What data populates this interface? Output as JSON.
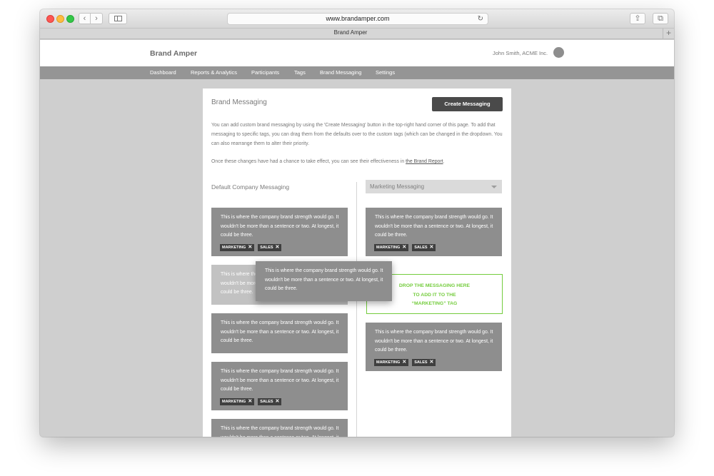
{
  "browser": {
    "url": "www.brandamper.com",
    "tab_title": "Brand Amper",
    "new_tab_glyph": "+",
    "back_glyph": "‹",
    "forward_glyph": "›",
    "reload_glyph": "↻",
    "share_glyph": "⇪",
    "tabs_glyph": "⧉"
  },
  "app": {
    "brand": "Brand Amper",
    "user": "John Smith, ACME Inc."
  },
  "nav": {
    "items": [
      "Dashboard",
      "Reports & Analytics",
      "Participants",
      "Tags",
      "Brand Messaging",
      "Settings"
    ]
  },
  "page": {
    "title": "Brand Messaging",
    "create_button": "Create Messaging",
    "intro": "You can add custom brand messaging by using the 'Create Messaging' button in the top-right hand corner of this page. To add that messaging to specific tags, you can drag them from the defaults over to the custom tags (which can be changed in the dropdown. You can also rearrange them to alter their priority.",
    "intro2_before": "Once these changes have had a chance to take effect, you can see their effectiveness in ",
    "intro2_link": "the Brand Report",
    "intro2_after": "."
  },
  "left_column": {
    "title": "Default Company Messaging",
    "cards": [
      {
        "text": "This is where the company brand strength would go. It wouldn't be more than a sentence or two. At longest, it could be three.",
        "tags": [
          "MARKETING",
          "SALES"
        ]
      },
      {
        "text": "This is where the company brand strength would go. It wouldn't be more than a sentence or two. At longest, it could be three.",
        "tags": []
      },
      {
        "text": "This is where the company brand strength would go. It wouldn't be more than a sentence or two. At longest, it could be three.",
        "tags": []
      },
      {
        "text": "This is where the company brand strength would go. It wouldn't be more than a sentence or two. At longest, it could be three.",
        "tags": [
          "MARKETING",
          "SALES"
        ]
      },
      {
        "text": "This is where the company brand strength would go. It wouldn't be more than a sentence or two. At longest, it could be three.",
        "tags": []
      }
    ]
  },
  "right_column": {
    "dropdown_value": "Marketing Messaging",
    "dropzone_text_lines": [
      "DROP THE MESSAGING HERE",
      "TO ADD IT TO THE",
      "“MARKETING” TAG"
    ],
    "cards": [
      {
        "text": "This is where the company brand strength would go. It wouldn't be more than a sentence or two. At longest, it could be three.",
        "tags": [
          "MARKETING",
          "SALES"
        ]
      },
      {
        "text": "This is where the company brand strength would go. It wouldn't be more than a sentence or two. At longest, it could be three.",
        "tags": [
          "MARKETING",
          "SALES"
        ]
      }
    ]
  },
  "dragged_card": {
    "text": "This is where the company brand strength would go. It wouldn't be more than a sentence or two. At longest, it could be three."
  },
  "tag_remove_glyph": "✕",
  "colors": {
    "nav_bg": "#959595",
    "card_bg": "#8e8e8e",
    "tag_bg": "#3f3f3f",
    "dropzone_accent": "#74cc3d",
    "button_bg": "#4a4a4a"
  }
}
